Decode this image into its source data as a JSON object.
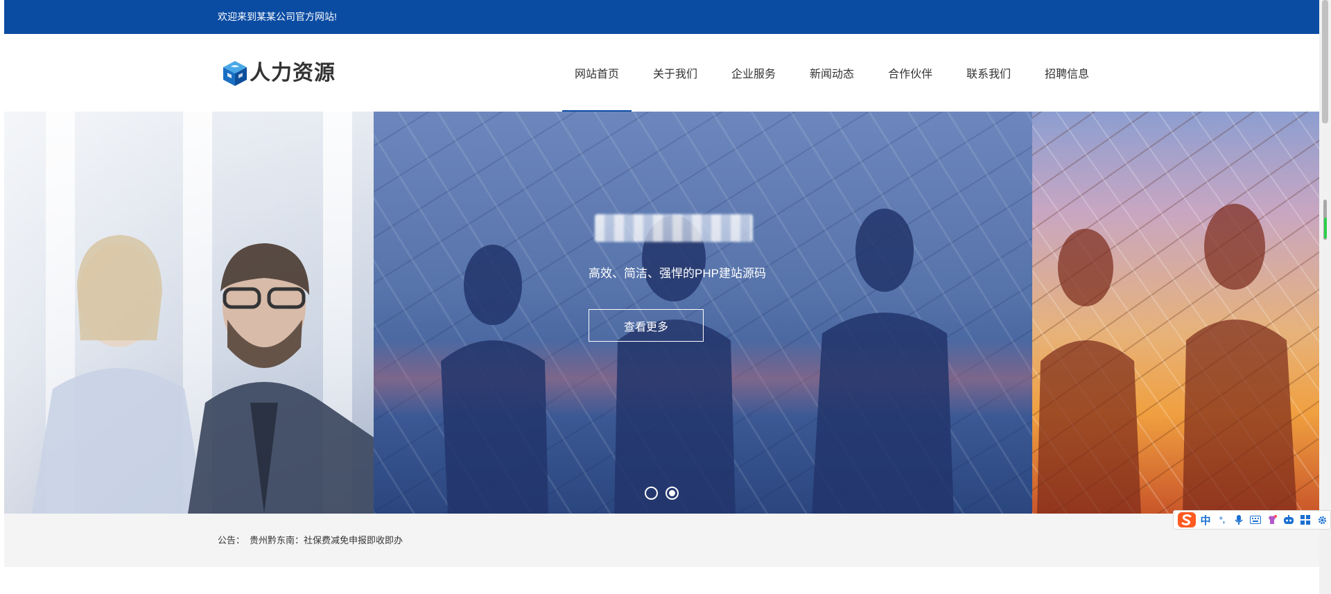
{
  "topbar": {
    "welcome": "欢迎来到某某公司官方网站!"
  },
  "header": {
    "logo_text": "人力资源",
    "nav": [
      {
        "label": "网站首页",
        "active": true
      },
      {
        "label": "关于我们"
      },
      {
        "label": "企业服务"
      },
      {
        "label": "新闻动态"
      },
      {
        "label": "合作伙伴"
      },
      {
        "label": "联系我们"
      },
      {
        "label": "招聘信息"
      }
    ]
  },
  "banner": {
    "subtitle": "高效、简洁、强悍的PHP建站源码",
    "button_label": "查看更多",
    "slide_count": 2,
    "active_slide": 2
  },
  "notice": {
    "label": "公告：",
    "text": "贵州黔东南：社保费减免申报即收即办"
  },
  "ime_toolbar": {
    "items": [
      "中",
      "°,",
      "mic-icon",
      "keyboard-icon",
      "skin-icon",
      "robot-icon",
      "grid-icon",
      "gear-icon"
    ],
    "accent": "#1a6fd1"
  },
  "colors": {
    "brand_blue": "#0b4ca3",
    "notice_bg": "#f4f4f4"
  }
}
